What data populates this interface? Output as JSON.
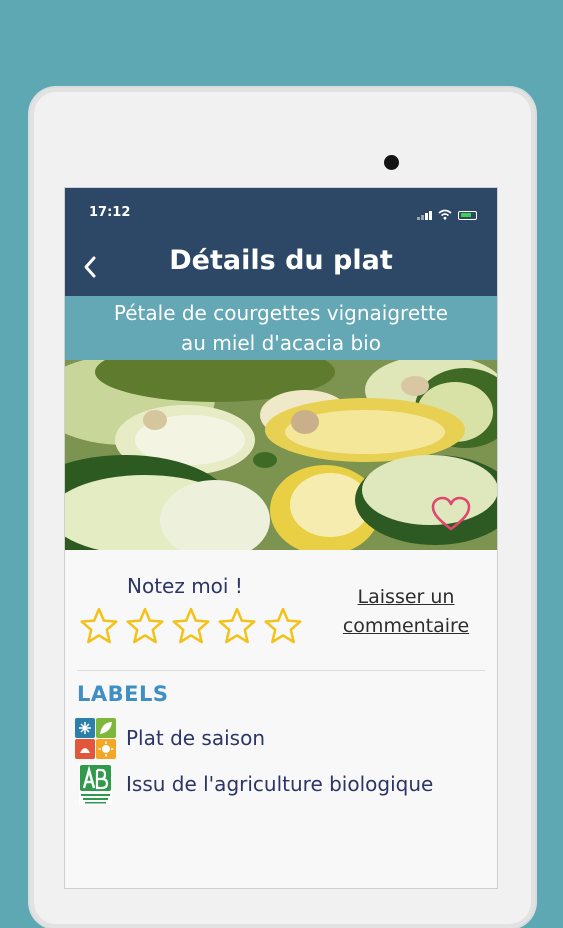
{
  "status_bar": {
    "time": "17:12"
  },
  "header": {
    "title": "Détails du plat",
    "back_icon": "chevron-left-icon"
  },
  "dish": {
    "name_line1": "Pétale de courgettes vignaigrette",
    "name_line2": "au miel d'acacia bio"
  },
  "favorite": {
    "icon": "heart-icon",
    "color": "#e0466e"
  },
  "rating": {
    "label": "Notez moi !",
    "value": 0,
    "max": 5,
    "star_color": "#f2c21b"
  },
  "comment": {
    "line1": "Laisser un",
    "line2": "commentaire"
  },
  "labels": {
    "heading": "LABELS",
    "items": [
      {
        "icon": "seasons-icon",
        "text": "Plat de saison"
      },
      {
        "icon": "ab-organic-icon",
        "text": "Issu de l'agriculture biologique"
      }
    ]
  },
  "colors": {
    "header": "#2c4866",
    "banner": "#64a7b5",
    "background": "#5ea8b4",
    "labels_heading": "#3f8fc5"
  }
}
